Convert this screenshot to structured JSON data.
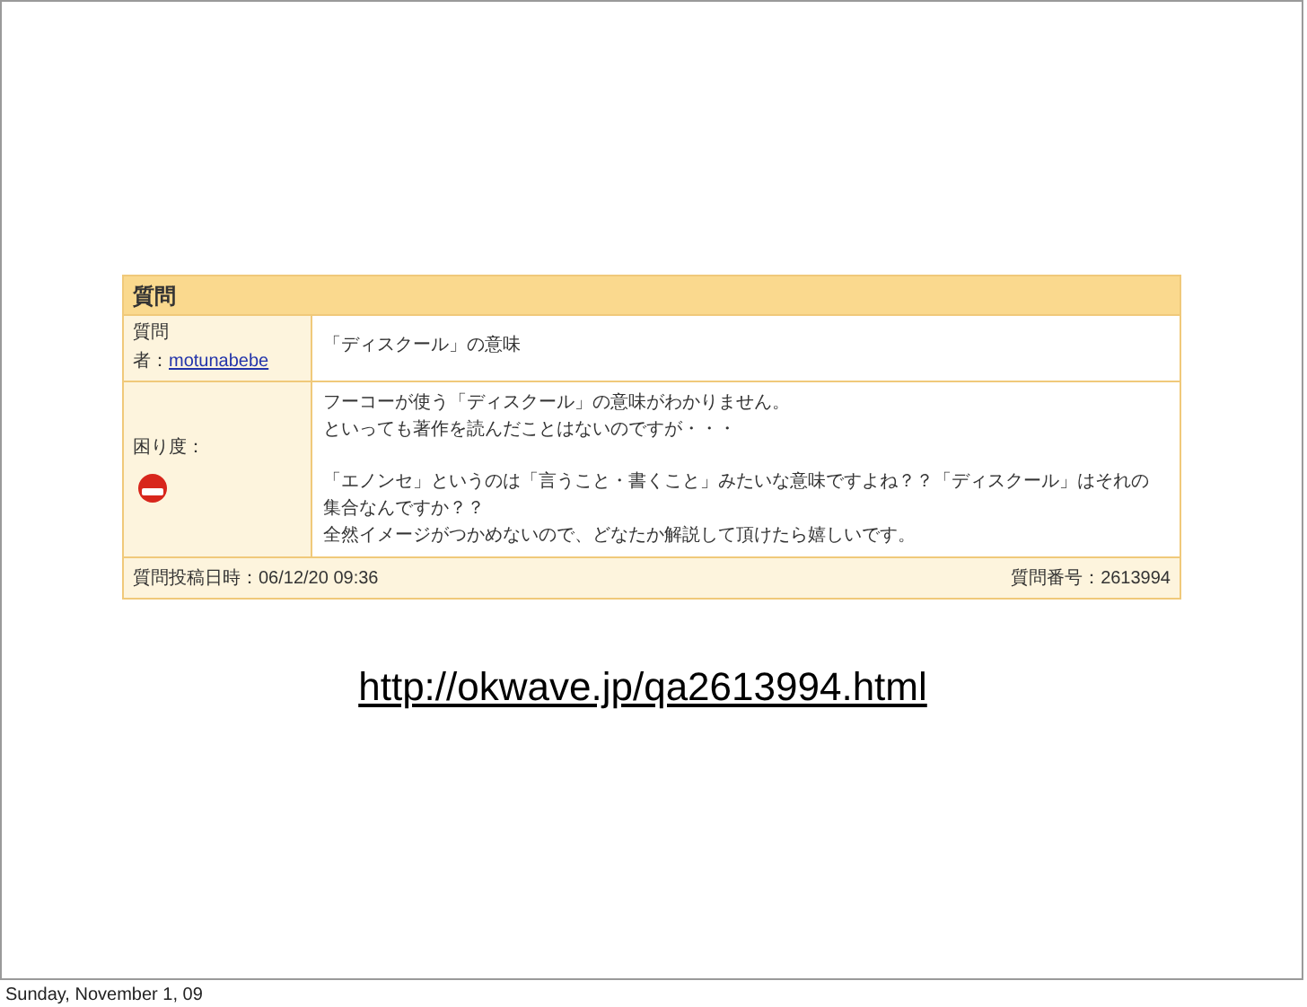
{
  "question_panel": {
    "heading": "質問",
    "title_label": "質問",
    "author_label": "者：",
    "author": "motunabebe",
    "title": "「ディスクール」の意味",
    "trouble_label": "困り度：",
    "body_paragraphs": [
      [
        "フーコーが使う「ディスクール」の意味がわかりません。",
        "といっても著作を読んだことはないのですが・・・"
      ],
      [
        "「エノンセ」というのは「言うこと・書くこと」みたいな意味ですよね？？「ディスクール」はそれの",
        "集合なんですか？？",
        "全然イメージがつかめないので、どなたか解説して頂けたら嬉しいです。"
      ]
    ],
    "posted": "質問投稿日時：06/12/20 09:36",
    "number": "質問番号：2613994"
  },
  "link": "http://okwave.jp/qa2613994.html",
  "footer_date": "Sunday, November 1, 09"
}
